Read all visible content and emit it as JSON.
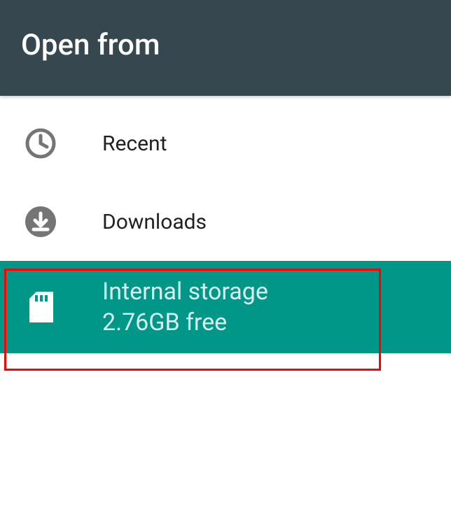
{
  "header": {
    "title": "Open from"
  },
  "list": {
    "items": [
      {
        "icon": "clock-icon",
        "label": "Recent",
        "sub": null,
        "selected": false
      },
      {
        "icon": "download-icon",
        "label": "Downloads",
        "sub": null,
        "selected": false
      },
      {
        "icon": "sdcard-icon",
        "label": "Internal storage",
        "sub": "2.76GB free",
        "selected": true
      }
    ]
  },
  "colors": {
    "headerBg": "#37474f",
    "accent": "#009688",
    "iconGray": "#757575",
    "highlight": "#ff0000"
  }
}
